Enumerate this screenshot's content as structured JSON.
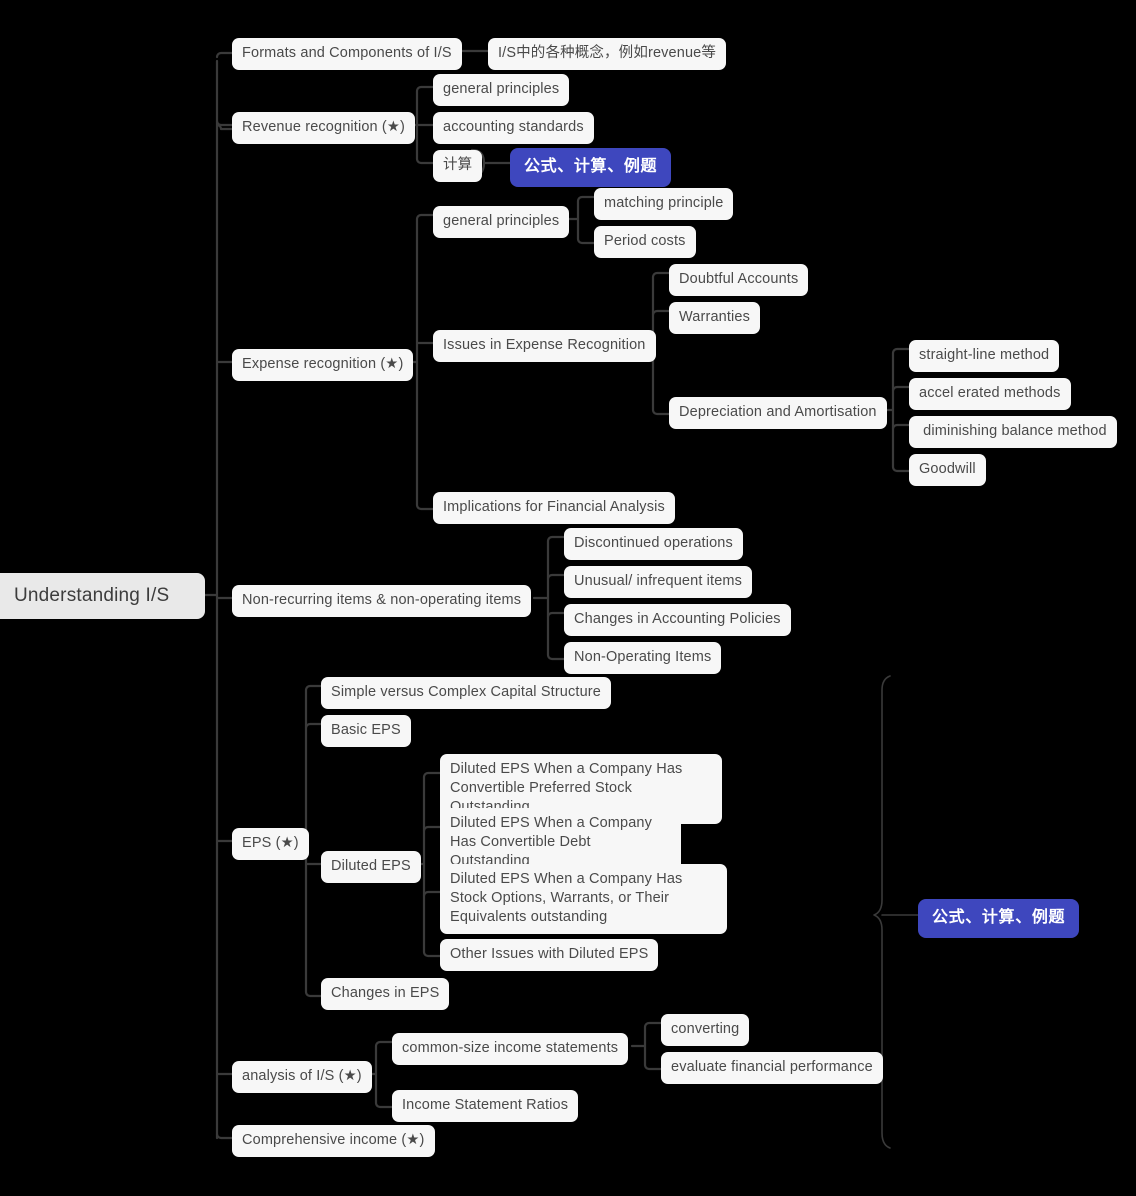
{
  "title": "Understanding I/S",
  "theme": {
    "background": "#000000",
    "node_fill": "#F7F7F7",
    "node_text": "#4A4A4A",
    "root_fill": "#E9E9E9",
    "accent_fill": "#3E47BE",
    "accent_text": "#FFFFFF",
    "connector": "#3A3A3A"
  },
  "root": {
    "label": "Understanding I/S"
  },
  "branches": [
    {
      "id": "formats",
      "label": "Formats and Components of I/S",
      "children": [
        {
          "id": "formats-note",
          "label": "I/S中的各种概念，例如revenue等"
        }
      ]
    },
    {
      "id": "revenue",
      "label": "Revenue recognition (★)",
      "children": [
        {
          "id": "rev-general",
          "label": "general principles"
        },
        {
          "id": "rev-standards",
          "label": "accounting standards"
        },
        {
          "id": "rev-calc",
          "label": "计算"
        }
      ]
    },
    {
      "id": "expense",
      "label": "Expense recognition (★)",
      "children": [
        {
          "id": "exp-general",
          "label": "general principles",
          "children": [
            {
              "id": "matching",
              "label": "matching principle"
            },
            {
              "id": "period-costs",
              "label": "Period costs"
            }
          ]
        },
        {
          "id": "exp-issues",
          "label": "Issues in Expense Recognition",
          "children": [
            {
              "id": "doubtful",
              "label": "Doubtful Accounts"
            },
            {
              "id": "warranties",
              "label": "Warranties"
            },
            {
              "id": "depreciation",
              "label": "Depreciation and Amortisation",
              "children": [
                {
                  "id": "straight-line",
                  "label": "straight-line method"
                },
                {
                  "id": "accelerated",
                  "label": "accel erated methods"
                },
                {
                  "id": "diminishing",
                  "label": " diminishing balance method"
                },
                {
                  "id": "goodwill",
                  "label": "Goodwill"
                }
              ]
            }
          ]
        },
        {
          "id": "exp-implications",
          "label": "Implications for Financial Analysis"
        }
      ]
    },
    {
      "id": "nonrecurring",
      "label": "Non-recurring items & non-operating items",
      "children": [
        {
          "id": "discontinued",
          "label": "Discontinued operations"
        },
        {
          "id": "unusual",
          "label": "Unusual/ infrequent items"
        },
        {
          "id": "acct-policies",
          "label": "Changes in Accounting Policies"
        },
        {
          "id": "nonoperating",
          "label": "Non-Operating Items"
        }
      ]
    },
    {
      "id": "eps",
      "label": "EPS (★)",
      "children": [
        {
          "id": "simple-complex",
          "label": "Simple versus Complex Capital Structure"
        },
        {
          "id": "basic-eps",
          "label": "Basic EPS"
        },
        {
          "id": "diluted-eps",
          "label": "Diluted EPS",
          "children": [
            {
              "id": "diluted-preferred",
              "label": "Diluted EPS When a Company Has Convertible Preferred Stock Outstanding"
            },
            {
              "id": "diluted-debt",
              "label": "Diluted EPS When a Company Has Convertible Debt Outstanding"
            },
            {
              "id": "diluted-options",
              "label": "Diluted EPS When a Company Has Stock Options, Warrants, or Their Equivalents outstanding"
            },
            {
              "id": "diluted-other",
              "label": "Other Issues with Diluted EPS"
            }
          ]
        },
        {
          "id": "changes-eps",
          "label": "Changes in EPS"
        }
      ]
    },
    {
      "id": "analysis",
      "label": "analysis of I/S (★)",
      "children": [
        {
          "id": "common-size",
          "label": "common-size income statements",
          "children": [
            {
              "id": "converting",
              "label": "converting"
            },
            {
              "id": "evaluate",
              "label": "evaluate financial performance"
            }
          ]
        },
        {
          "id": "is-ratios",
          "label": "Income Statement Ratios"
        }
      ]
    },
    {
      "id": "comprehensive",
      "label": "Comprehensive income (★)",
      "children": []
    }
  ],
  "callouts": [
    {
      "id": "callout-revenue",
      "label": "公式、计算、例题"
    },
    {
      "id": "callout-eps",
      "label": "公式、计算、例题"
    }
  ]
}
